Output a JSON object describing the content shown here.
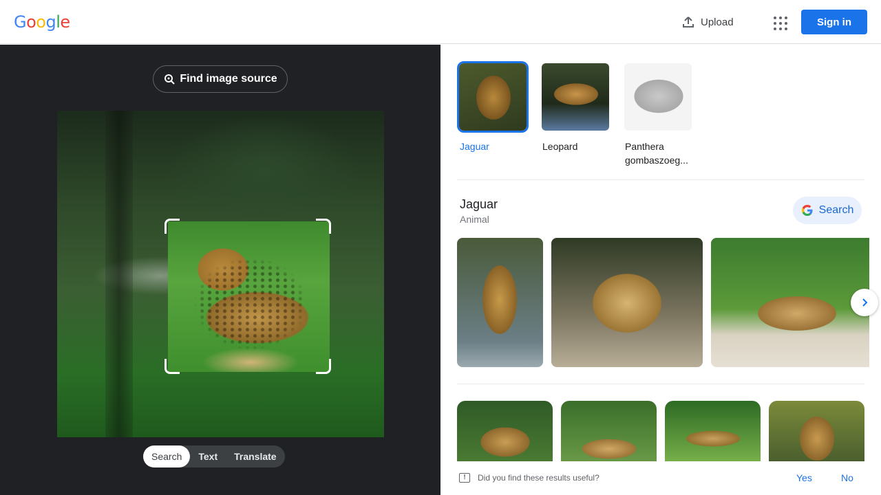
{
  "header": {
    "logo_letters": [
      "G",
      "o",
      "o",
      "g",
      "l",
      "e"
    ],
    "upload_label": "Upload",
    "signin_label": "Sign in",
    "colors": {
      "primary": "#1a73e8",
      "logo_blue": "#4285f4",
      "logo_red": "#ea4335",
      "logo_yellow": "#fbbc05",
      "logo_green": "#34a853"
    }
  },
  "left_panel": {
    "find_source_label": "Find image source",
    "mode_tabs": [
      {
        "label": "Search",
        "active": true
      },
      {
        "label": "Text",
        "active": false
      },
      {
        "label": "Translate",
        "active": false
      }
    ],
    "background": "#202124"
  },
  "right_panel": {
    "entity_chips": [
      {
        "label": "Jaguar",
        "active": true
      },
      {
        "label": "Leopard",
        "active": false
      },
      {
        "label": "Panthera gombaszoeg...",
        "active": false
      }
    ],
    "entity": {
      "title": "Jaguar",
      "subtitle": "Animal",
      "search_label": "Search"
    },
    "feedback": {
      "question": "Did you find these results useful?",
      "yes_label": "Yes",
      "no_label": "No"
    }
  }
}
